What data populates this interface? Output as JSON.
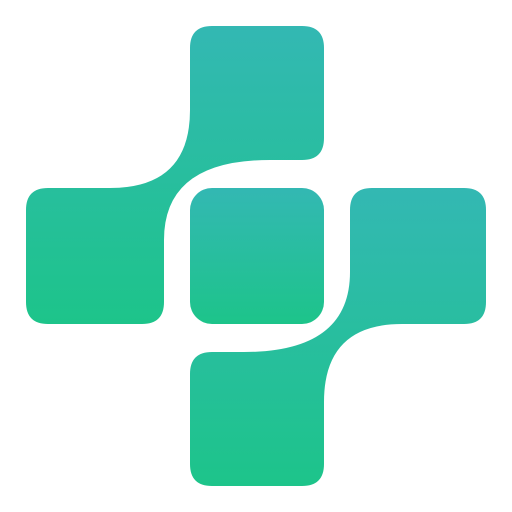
{
  "logo": {
    "icon": "medical-cross-icon",
    "gradient": {
      "top": "#33b8b3",
      "bottom": "#1dc48a"
    },
    "background": "#ffffff"
  }
}
